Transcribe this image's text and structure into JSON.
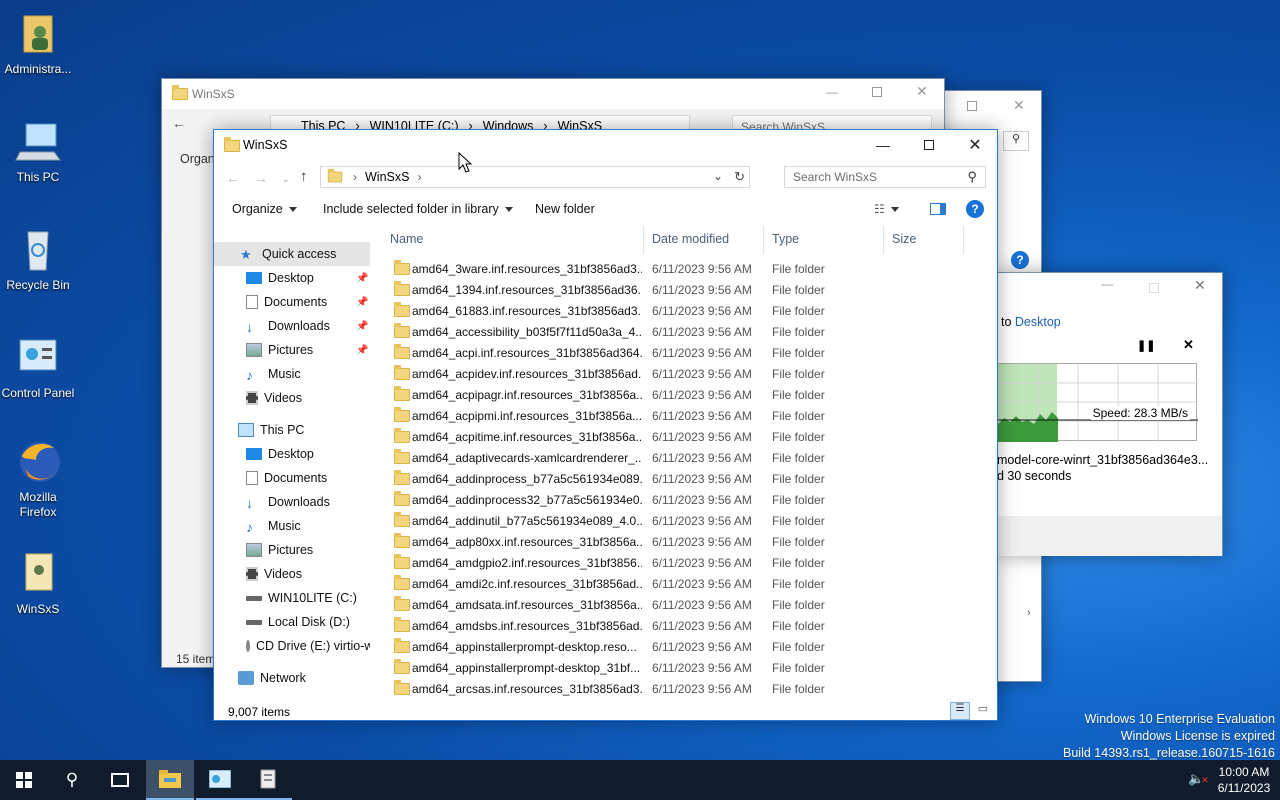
{
  "desktop": {
    "icons": [
      {
        "label": "Administra..."
      },
      {
        "label": "This PC"
      },
      {
        "label": "Recycle Bin"
      },
      {
        "label": "Control Panel"
      },
      {
        "label": "Mozilla Firefox"
      },
      {
        "label": "WinSxS"
      }
    ],
    "watermark": {
      "line1": "Windows 10 Enterprise Evaluation",
      "line2": "Windows License is expired",
      "line3": "Build 14393.rs1_release.160715-1616"
    }
  },
  "back_window": {
    "title": "WinSxS",
    "breadcrumb": [
      "This PC",
      "WIN10LITE (C:)",
      "Windows",
      "WinSxS"
    ],
    "search_placeholder": "Search WinSxS",
    "ribbon_label": "Organ",
    "status": "15 item"
  },
  "copy_dialog": {
    "dest_prefix": "to ",
    "dest_link": "Desktop",
    "speed": "Speed: 28.3 MB/s",
    "file_name": "model-core-winrt_31bf3856ad364e3...",
    "time_left": "d 30 seconds",
    "progress": 0.3
  },
  "main_window": {
    "title": "WinSxS",
    "address": {
      "crumbs": [
        "WinSxS"
      ],
      "search_placeholder": "Search WinSxS"
    },
    "ribbon": {
      "organize": "Organize",
      "include": "Include selected folder in library",
      "new_folder": "New folder"
    },
    "nav": {
      "quick_access": "Quick access",
      "quick_items": [
        "Desktop",
        "Documents",
        "Downloads",
        "Pictures",
        "Music",
        "Videos"
      ],
      "this_pc": "This PC",
      "pc_items": [
        "Desktop",
        "Documents",
        "Downloads",
        "Music",
        "Pictures",
        "Videos",
        "WIN10LITE (C:)",
        "Local Disk (D:)",
        "CD Drive (E:) virtio-win"
      ],
      "network": "Network"
    },
    "columns": {
      "name": "Name",
      "date": "Date modified",
      "type": "Type",
      "size": "Size"
    },
    "files": [
      {
        "name": "amd64_3ware.inf.resources_31bf3856ad3...",
        "date": "6/11/2023 9:56 AM",
        "type": "File folder"
      },
      {
        "name": "amd64_1394.inf.resources_31bf3856ad36...",
        "date": "6/11/2023 9:56 AM",
        "type": "File folder"
      },
      {
        "name": "amd64_61883.inf.resources_31bf3856ad3...",
        "date": "6/11/2023 9:56 AM",
        "type": "File folder"
      },
      {
        "name": "amd64_accessibility_b03f5f7f11d50a3a_4....",
        "date": "6/11/2023 9:56 AM",
        "type": "File folder"
      },
      {
        "name": "amd64_acpi.inf.resources_31bf3856ad364...",
        "date": "6/11/2023 9:56 AM",
        "type": "File folder"
      },
      {
        "name": "amd64_acpidev.inf.resources_31bf3856ad...",
        "date": "6/11/2023 9:56 AM",
        "type": "File folder"
      },
      {
        "name": "amd64_acpipagr.inf.resources_31bf3856a...",
        "date": "6/11/2023 9:56 AM",
        "type": "File folder"
      },
      {
        "name": "amd64_acpipmi.inf.resources_31bf3856a...",
        "date": "6/11/2023 9:56 AM",
        "type": "File folder"
      },
      {
        "name": "amd64_acpitime.inf.resources_31bf3856a...",
        "date": "6/11/2023 9:56 AM",
        "type": "File folder"
      },
      {
        "name": "amd64_adaptivecards-xamlcardrenderer_...",
        "date": "6/11/2023 9:56 AM",
        "type": "File folder"
      },
      {
        "name": "amd64_addinprocess_b77a5c561934e089....",
        "date": "6/11/2023 9:56 AM",
        "type": "File folder"
      },
      {
        "name": "amd64_addinprocess32_b77a5c561934e0...",
        "date": "6/11/2023 9:56 AM",
        "type": "File folder"
      },
      {
        "name": "amd64_addinutil_b77a5c561934e089_4.0....",
        "date": "6/11/2023 9:56 AM",
        "type": "File folder"
      },
      {
        "name": "amd64_adp80xx.inf.resources_31bf3856a...",
        "date": "6/11/2023 9:56 AM",
        "type": "File folder"
      },
      {
        "name": "amd64_amdgpio2.inf.resources_31bf3856...",
        "date": "6/11/2023 9:56 AM",
        "type": "File folder"
      },
      {
        "name": "amd64_amdi2c.inf.resources_31bf3856ad...",
        "date": "6/11/2023 9:56 AM",
        "type": "File folder"
      },
      {
        "name": "amd64_amdsata.inf.resources_31bf3856a...",
        "date": "6/11/2023 9:56 AM",
        "type": "File folder"
      },
      {
        "name": "amd64_amdsbs.inf.resources_31bf3856ad...",
        "date": "6/11/2023 9:56 AM",
        "type": "File folder"
      },
      {
        "name": "amd64_appinstallerprompt-desktop.reso...",
        "date": "6/11/2023 9:56 AM",
        "type": "File folder"
      },
      {
        "name": "amd64_appinstallerprompt-desktop_31bf...",
        "date": "6/11/2023 9:56 AM",
        "type": "File folder"
      },
      {
        "name": "amd64_arcsas.inf.resources_31bf3856ad3...",
        "date": "6/11/2023 9:56 AM",
        "type": "File folder"
      }
    ],
    "status": "9,007 items"
  },
  "taskbar": {
    "time": "10:00 AM",
    "date": "6/11/2023"
  },
  "colors": {
    "accent": "#1a73d9",
    "taskbar": "#101c2c",
    "help": "#1a73d9"
  }
}
